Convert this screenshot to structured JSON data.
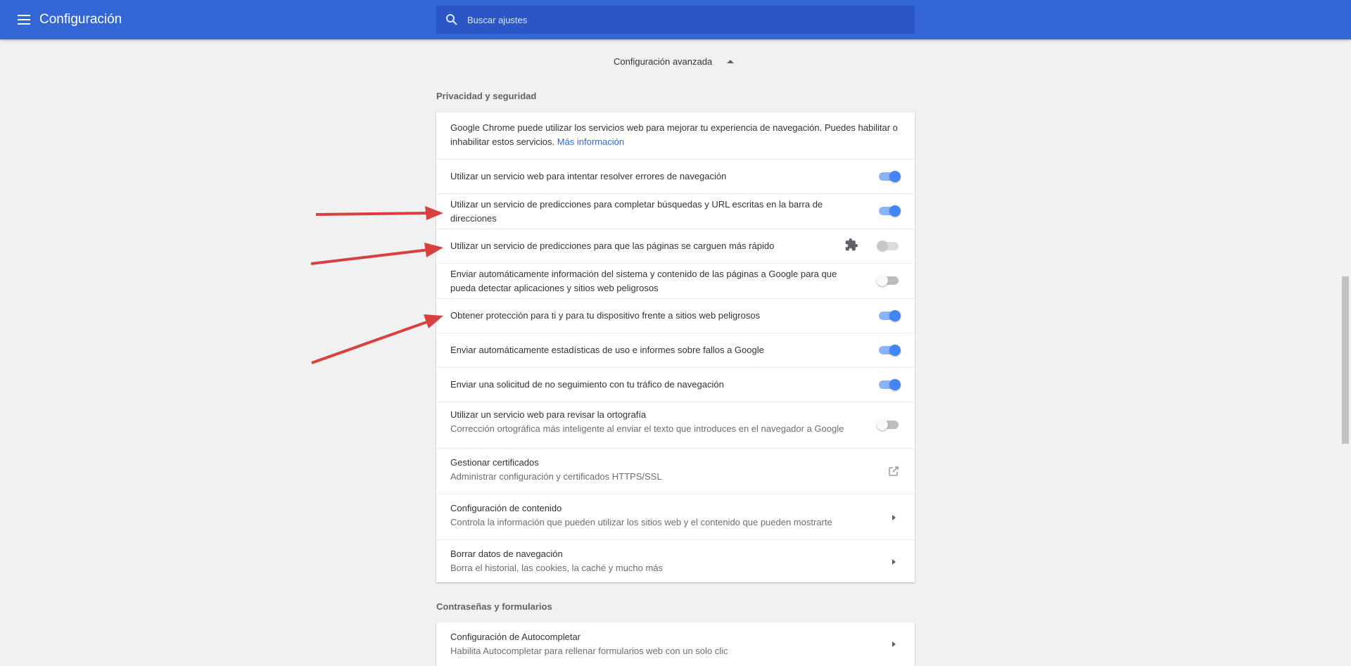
{
  "header": {
    "title": "Configuración",
    "search_placeholder": "Buscar ajustes",
    "menu_icon": "hamburger-menu-icon",
    "search_icon": "search-icon"
  },
  "advanced": {
    "label": "Configuración avanzada",
    "icon": "caret-up-icon"
  },
  "privacy": {
    "title": "Privacidad y seguridad",
    "intro_text": "Google Chrome puede utilizar los servicios web para mejorar tu experiencia de navegación. Puedes habilitar o inhabilitar estos servicios.",
    "intro_link": "Más información",
    "rows": [
      {
        "label": "Utilizar un servicio web para intentar resolver errores de navegación",
        "state": "on"
      },
      {
        "label": "Utilizar un servicio de predicciones para completar búsquedas y URL escritas en la barra de direcciones",
        "state": "on"
      },
      {
        "label": "Utilizar un servicio de predicciones para que las páginas se carguen más rápido",
        "state": "disabled",
        "icon": "puzzle-extension-icon"
      },
      {
        "label": "Enviar automáticamente información del sistema y contenido de las páginas a Google para que pueda detectar aplicaciones y sitios web peligrosos",
        "state": "off"
      },
      {
        "label": "Obtener protección para ti y para tu dispositivo frente a sitios web peligrosos",
        "state": "on"
      },
      {
        "label": "Enviar automáticamente estadísticas de uso e informes sobre fallos a Google",
        "state": "on"
      },
      {
        "label": "Enviar una solicitud de no seguimiento con tu tráfico de navegación",
        "state": "on"
      },
      {
        "label": "Utilizar un servicio web para revisar la ortografía",
        "sublabel": "Corrección ortográfica más inteligente al enviar el texto que introduces en el navegador a Google",
        "state": "off"
      }
    ],
    "links": [
      {
        "label": "Gestionar certificados",
        "sublabel": "Administrar configuración y certificados HTTPS/SSL",
        "icon": "open-in-new-icon"
      },
      {
        "label": "Configuración de contenido",
        "sublabel": "Controla la información que pueden utilizar los sitios web y el contenido que pueden mostrarte",
        "icon": "arrow-right-icon"
      },
      {
        "label": "Borrar datos de navegación",
        "sublabel": "Borra el historial, las cookies, la caché y mucho más",
        "icon": "arrow-right-icon"
      }
    ]
  },
  "passwords": {
    "title": "Contraseñas y formularios",
    "rows": [
      {
        "label": "Configuración de Autocompletar",
        "sublabel": "Habilita Autocompletar para rellenar formularios web con un solo clic",
        "icon": "arrow-right-icon"
      }
    ]
  },
  "colors": {
    "accent": "#3367d6",
    "toggle_on": "#4285f4",
    "annotation_arrow": "#d94141"
  }
}
